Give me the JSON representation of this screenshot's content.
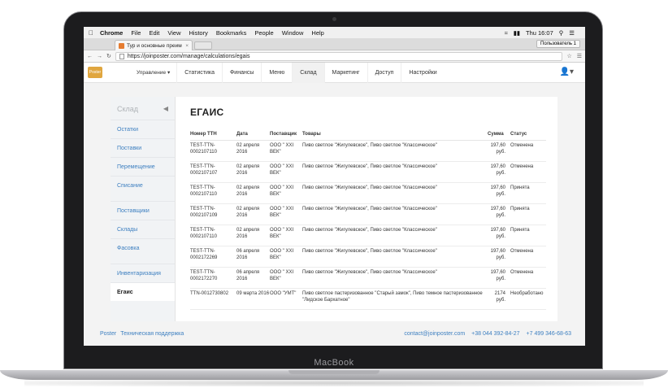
{
  "device": {
    "brand": "MacBook"
  },
  "menubar": {
    "app_name": "Chrome",
    "items": [
      "File",
      "Edit",
      "View",
      "History",
      "Bookmarks",
      "People",
      "Window",
      "Help"
    ],
    "clock": "Thu 16:07"
  },
  "browser": {
    "tab_title": "Тур и основные преим",
    "user_button": "Пользователь 1",
    "url": "https://joinposter.com/manage/calculations/egais"
  },
  "app": {
    "logo_text": "Poster",
    "management_label": "Управление ▾",
    "nav": [
      {
        "label": "Статистика"
      },
      {
        "label": "Финансы"
      },
      {
        "label": "Меню"
      },
      {
        "label": "Склад"
      },
      {
        "label": "Маркетинг"
      },
      {
        "label": "Доступ"
      },
      {
        "label": "Настройки"
      }
    ],
    "active_nav": "Склад"
  },
  "sidebar": {
    "title": "Склад",
    "group1": [
      {
        "label": "Остатки"
      },
      {
        "label": "Поставки"
      },
      {
        "label": "Перемещение"
      },
      {
        "label": "Списание"
      }
    ],
    "group2": [
      {
        "label": "Поставщики"
      },
      {
        "label": "Склады"
      },
      {
        "label": "Фасовка"
      }
    ],
    "group3": [
      {
        "label": "Инвентаризация"
      },
      {
        "label": "Егаис"
      }
    ]
  },
  "page": {
    "title": "ЕГАИС",
    "columns": {
      "number": "Номер ТТН",
      "date": "Дата",
      "supplier": "Поставщик",
      "goods": "Товары",
      "sum": "Сумма",
      "status": "Статус"
    },
    "rows": [
      {
        "number": "TEST-TTN-0002107110",
        "date": "02 апреля 2016",
        "supplier": "ООО \" XXI ВЕК\"",
        "goods": "Пиво светлое \"Жигулевское\", Пиво светлое \"Классическое\"",
        "sum": "197,60 руб.",
        "status": "Отменена"
      },
      {
        "number": "TEST-TTN-0002107107",
        "date": "02 апреля 2016",
        "supplier": "ООО \" XXI ВЕК\"",
        "goods": "Пиво светлое \"Жигулевское\", Пиво светлое \"Классическое\"",
        "sum": "197,60 руб.",
        "status": "Отменена"
      },
      {
        "number": "TEST-TTN-0002107110",
        "date": "02 апреля 2016",
        "supplier": "ООО \" XXI ВЕК\"",
        "goods": "Пиво светлое \"Жигулевское\", Пиво светлое \"Классическое\"",
        "sum": "197,60 руб.",
        "status": "Принята"
      },
      {
        "number": "TEST-TTN-0002107109",
        "date": "02 апреля 2016",
        "supplier": "ООО \" XXI ВЕК\"",
        "goods": "Пиво светлое \"Жигулевское\", Пиво светлое \"Классическое\"",
        "sum": "197,60 руб.",
        "status": "Принята"
      },
      {
        "number": "TEST-TTN-0002107110",
        "date": "02 апреля 2016",
        "supplier": "ООО \" XXI ВЕК\"",
        "goods": "Пиво светлое \"Жигулевское\", Пиво светлое \"Классическое\"",
        "sum": "197,60 руб.",
        "status": "Принята"
      },
      {
        "number": "TEST-TTN-0002172269",
        "date": "06 апреля 2016",
        "supplier": "ООО \" XXI ВЕК\"",
        "goods": "Пиво светлое \"Жигулевское\", Пиво светлое \"Классическое\"",
        "sum": "197,60 руб.",
        "status": "Отменена"
      },
      {
        "number": "TEST-TTN-0002172270",
        "date": "06 апреля 2016",
        "supplier": "ООО \" XXI ВЕК\"",
        "goods": "Пиво светлое \"Жигулевское\", Пиво светлое \"Классическое\"",
        "sum": "197,60 руб.",
        "status": "Отменена"
      },
      {
        "number": "TTN-0012730802",
        "date": "09 марта 2016",
        "supplier": "ООО \"УМТ\"",
        "goods": "Пиво светлое пастеризованное \"Старый замок\", Пиво темное пастеризованное \"Лидское Бархатное\"",
        "sum": "2174 руб.",
        "status": "Необработано"
      }
    ]
  },
  "footer": {
    "poster": "Poster",
    "support": "Техническая поддержка",
    "email": "contact@joinposter.com",
    "phone1": "+38 044 392-84-27",
    "phone2": "+7 499 346-68-63"
  },
  "colors": {
    "link": "#3d7fc0",
    "logo": "#e0a63f"
  }
}
